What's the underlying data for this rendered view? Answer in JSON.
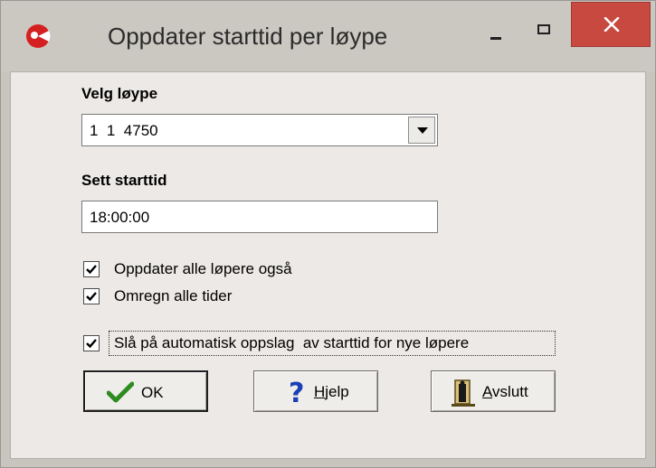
{
  "window": {
    "title": "Oppdater starttid per løype"
  },
  "form": {
    "course_label": "Velg løype",
    "course_value": "1  1  4750",
    "starttime_label": "Sett starttid",
    "starttime_value": "18:00:00"
  },
  "checkboxes": [
    {
      "label": "Oppdater alle løpere også",
      "checked": true
    },
    {
      "label": "Omregn alle tider",
      "checked": true
    },
    {
      "label": "Slå på automatisk oppslag  av starttid for nye løpere",
      "checked": true
    }
  ],
  "buttons": {
    "ok": {
      "label": "OK"
    },
    "help": {
      "mnemonic": "H",
      "rest": "jelp"
    },
    "exit": {
      "mnemonic": "A",
      "rest": "vslutt"
    }
  },
  "colors": {
    "close_button": "#c7493f",
    "app_icon": "#d42020",
    "ok_check": "#2e8b1f",
    "help_icon": "#1b3fb5"
  },
  "icons": {
    "app": "app-logo-icon",
    "ok": "checkmark-icon",
    "help": "question-mark-icon",
    "exit": "door-exit-icon"
  }
}
